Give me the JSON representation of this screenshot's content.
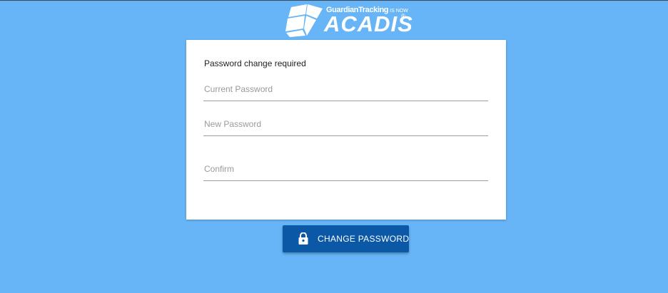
{
  "header": {
    "logo": {
      "tagline": "GuardianTracking",
      "tagline_suffix": "IS NOW",
      "wordmark": "ACADIS",
      "registered_mark": "®"
    }
  },
  "form": {
    "heading": "Password change required",
    "current_password": {
      "placeholder": "Current Password",
      "value": ""
    },
    "new_password": {
      "placeholder": "New Password",
      "value": ""
    },
    "confirm": {
      "placeholder": "Confirm",
      "value": ""
    }
  },
  "actions": {
    "change_password_label": "CHANGE PASSWORD",
    "icon": "lock-icon"
  },
  "colors": {
    "background": "#67b5f7",
    "card": "#ffffff",
    "button": "#0b58a6"
  }
}
